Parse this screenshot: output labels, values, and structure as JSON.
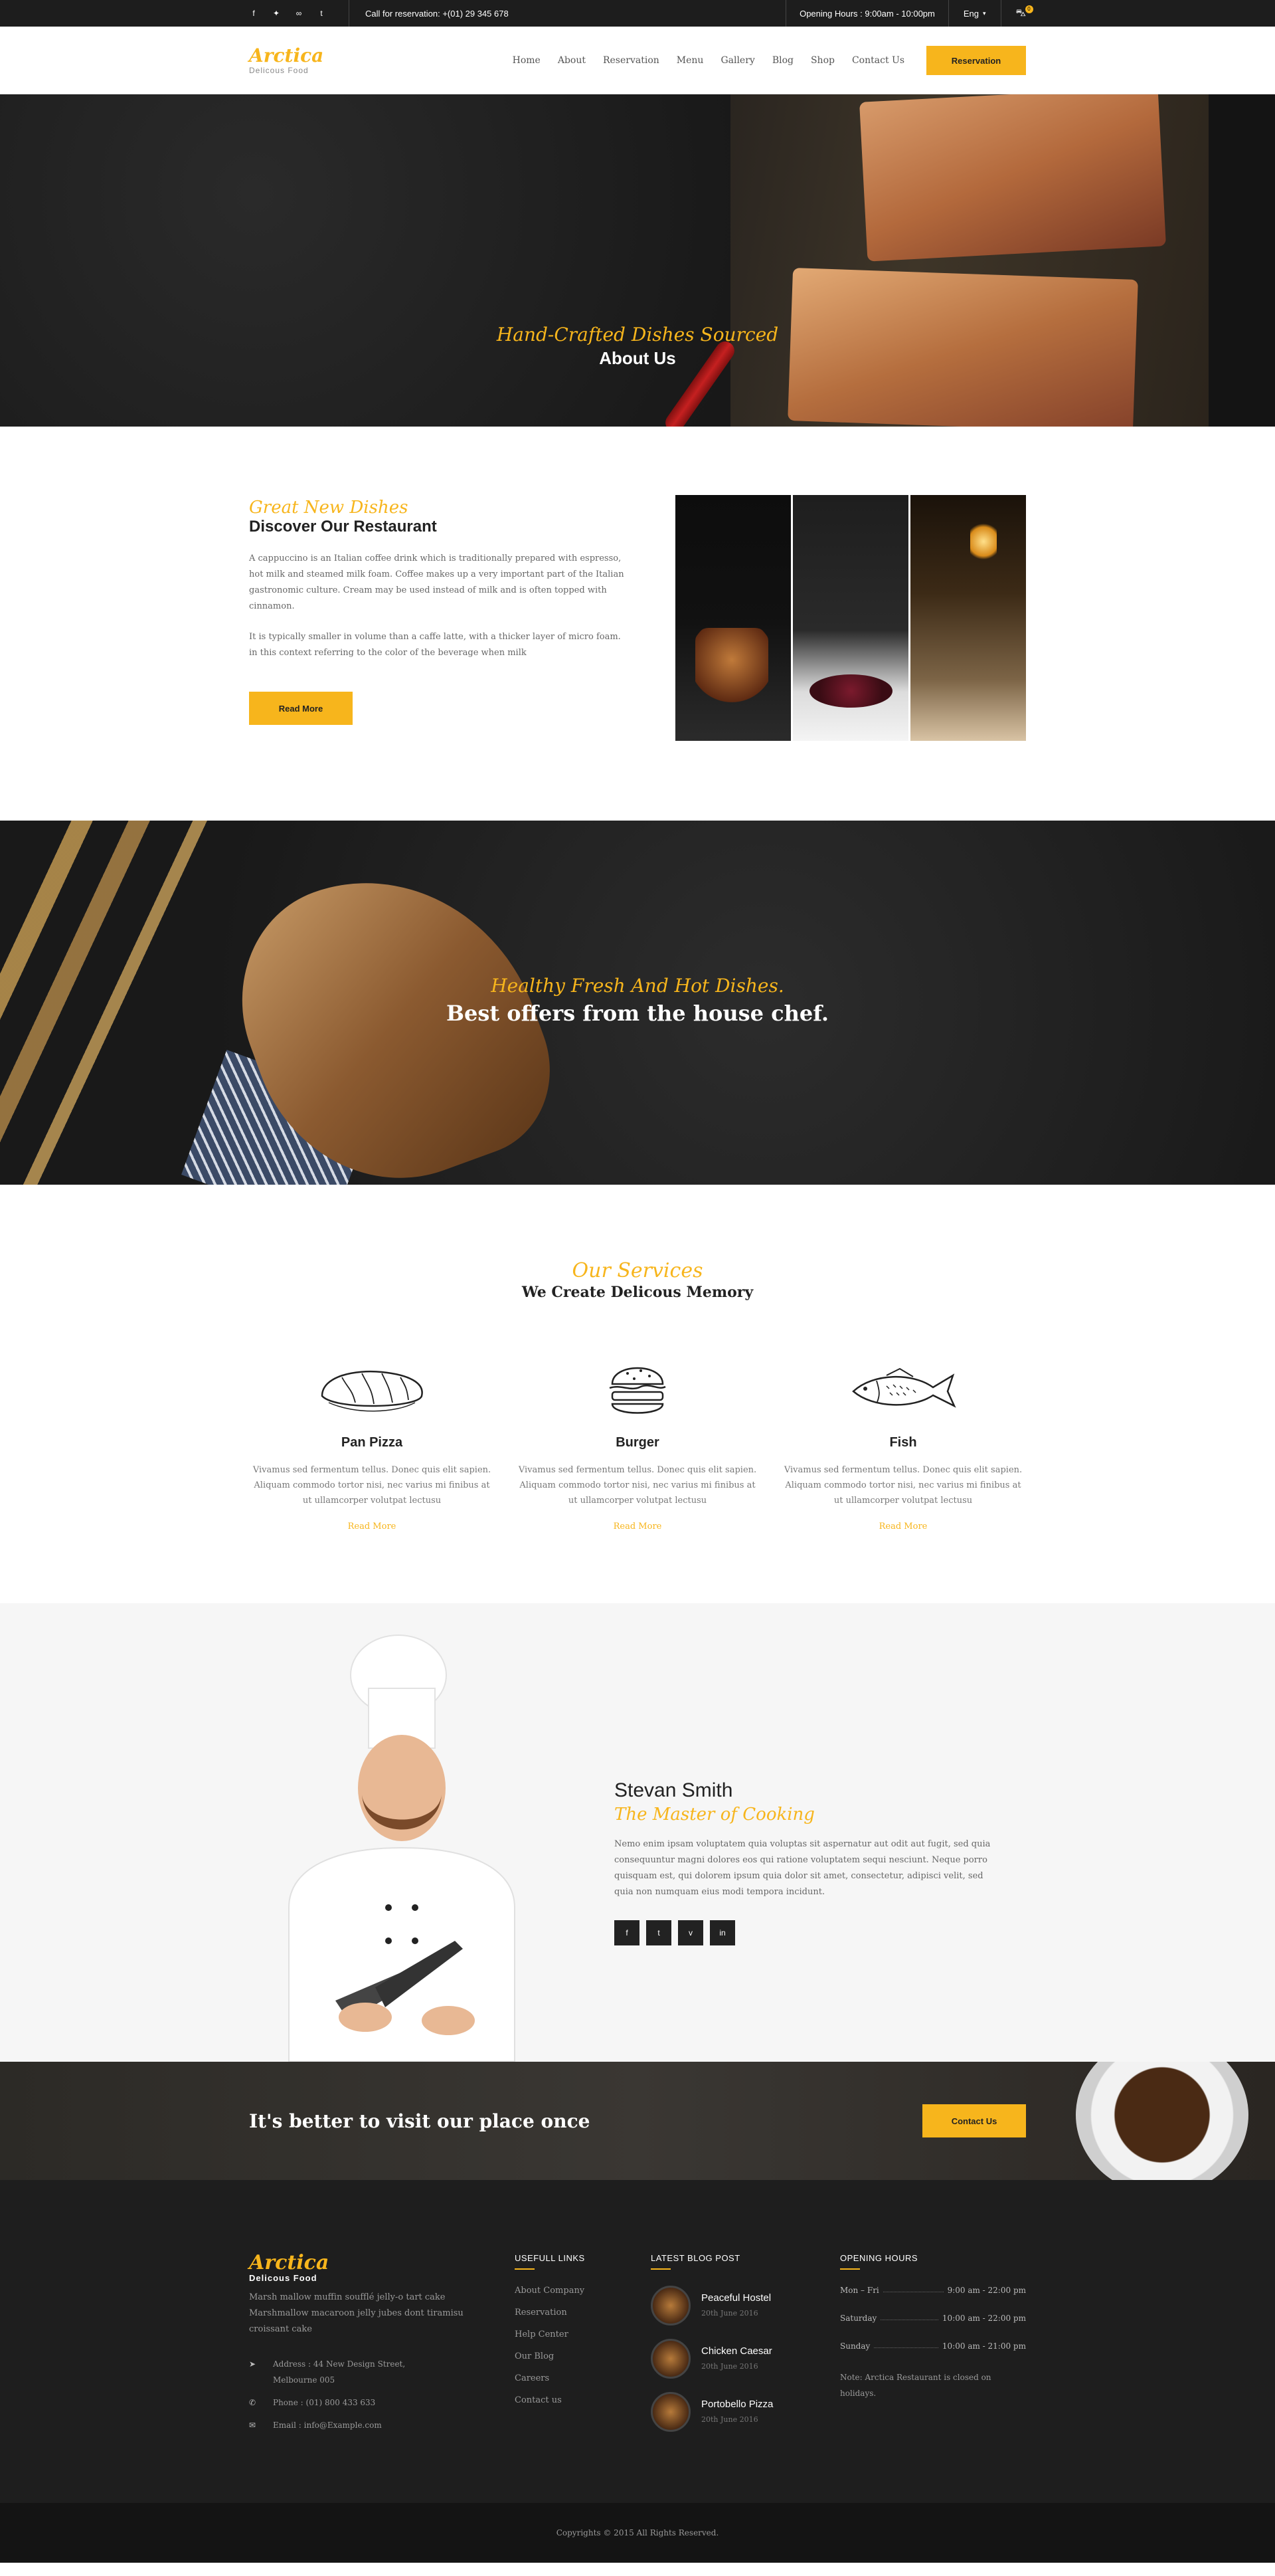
{
  "topbar": {
    "social": [
      "f",
      "t",
      "ta",
      "t"
    ],
    "call": "Call for reservation: +(01) 29 345 678",
    "hours": "Opening Hours : 9:00am - 10:00pm",
    "lang": "Eng",
    "cart_count": "0"
  },
  "header": {
    "brand": "Arctica",
    "tagline": "Delicous Food",
    "nav": [
      "Home",
      "About",
      "Reservation",
      "Menu",
      "Gallery",
      "Blog",
      "Shop",
      "Contact Us"
    ],
    "cta": "Reservation"
  },
  "hero": {
    "script": "Hand-Crafted Dishes Sourced",
    "title": "About Us"
  },
  "about": {
    "script": "Great New Dishes",
    "title": "Discover Our Restaurant",
    "p1": "A cappuccino is an Italian coffee drink which is traditionally prepared with espresso, hot milk and steamed milk foam. Coffee makes up a very important part of the Italian gastronomic culture. Cream may be used instead of milk and is often topped with cinnamon.",
    "p2": "It is typically smaller in volume than a caffe latte, with a thicker layer of micro foam. in this context referring to the color of the beverage when milk",
    "button": "Read More"
  },
  "offers": {
    "script": "Healthy Fresh And Hot Dishes.",
    "title": "Best offers from the house chef."
  },
  "services": {
    "script": "Our Services",
    "title": "We Create Delicous Memory",
    "items": [
      {
        "title": "Pan Pizza",
        "text": "Vivamus sed fermentum tellus. Donec quis elit sapien. Aliquam commodo tortor nisi, nec varius mi finibus at ut ullamcorper volutpat lectusu",
        "more": "Read More",
        "icon": "bread-icon"
      },
      {
        "title": "Burger",
        "text": "Vivamus sed fermentum tellus. Donec quis elit sapien. Aliquam commodo tortor nisi, nec varius mi finibus at ut ullamcorper volutpat lectusu",
        "more": "Read More",
        "icon": "burger-icon"
      },
      {
        "title": "Fish",
        "text": "Vivamus sed fermentum tellus. Donec quis elit sapien. Aliquam commodo tortor nisi, nec varius mi finibus at ut ullamcorper volutpat lectusu",
        "more": "Read More",
        "icon": "fish-icon"
      }
    ]
  },
  "chef": {
    "name": "Stevan Smith",
    "role": "The Master of Cooking",
    "bio": "Nemo enim ipsam voluptatem quia voluptas sit aspernatur aut odit aut fugit, sed quia consequuntur magni dolores eos qui ratione voluptatem sequi nesciunt. Neque porro quisquam est, qui dolorem ipsum quia dolor sit amet, consectetur, adipisci velit, sed quia non numquam eius modi tempora incidunt.",
    "social": [
      "f",
      "t",
      "v",
      "in"
    ]
  },
  "visit": {
    "title": "It's better to visit our place once",
    "button": "Contact Us"
  },
  "footer": {
    "brand": "Arctica",
    "tagline": "Delicous Food",
    "about": "Marsh mallow muffin soufflé jelly-o tart cake Marshmallow macaroon jelly jubes dont tiramisu croissant cake",
    "address": "Address : 44 New Design Street, Melbourne 005",
    "phone": "Phone : (01) 800 433 633",
    "email": "Email : info@Example.com",
    "links_title": "USEFULL LINKS",
    "links": [
      "About Company",
      "Reservation",
      "Help Center",
      "Our Blog",
      "Careers",
      "Contact us"
    ],
    "blog_title": "LATEST BLOG POST",
    "posts": [
      {
        "title": "Peaceful Hostel",
        "date": "20th June 2016"
      },
      {
        "title": "Chicken Caesar",
        "date": "20th June 2016"
      },
      {
        "title": "Portobello Pizza",
        "date": "20th June 2016"
      }
    ],
    "hours_title": "OPENING HOURS",
    "hours": [
      {
        "day": "Mon – Fri",
        "time": "9:00 am - 22:00 pm"
      },
      {
        "day": "Saturday",
        "time": "10:00 am - 22:00 pm"
      },
      {
        "day": "Sunday",
        "time": "10:00 am - 21:00 pm"
      }
    ],
    "note": "Note: Arctica Restaurant is closed on holidays.",
    "copyright": "Copyrights © 2015  All Rights Reserved."
  },
  "colors": {
    "accent": "#f7b51c",
    "dark": "#1e1e1e"
  }
}
